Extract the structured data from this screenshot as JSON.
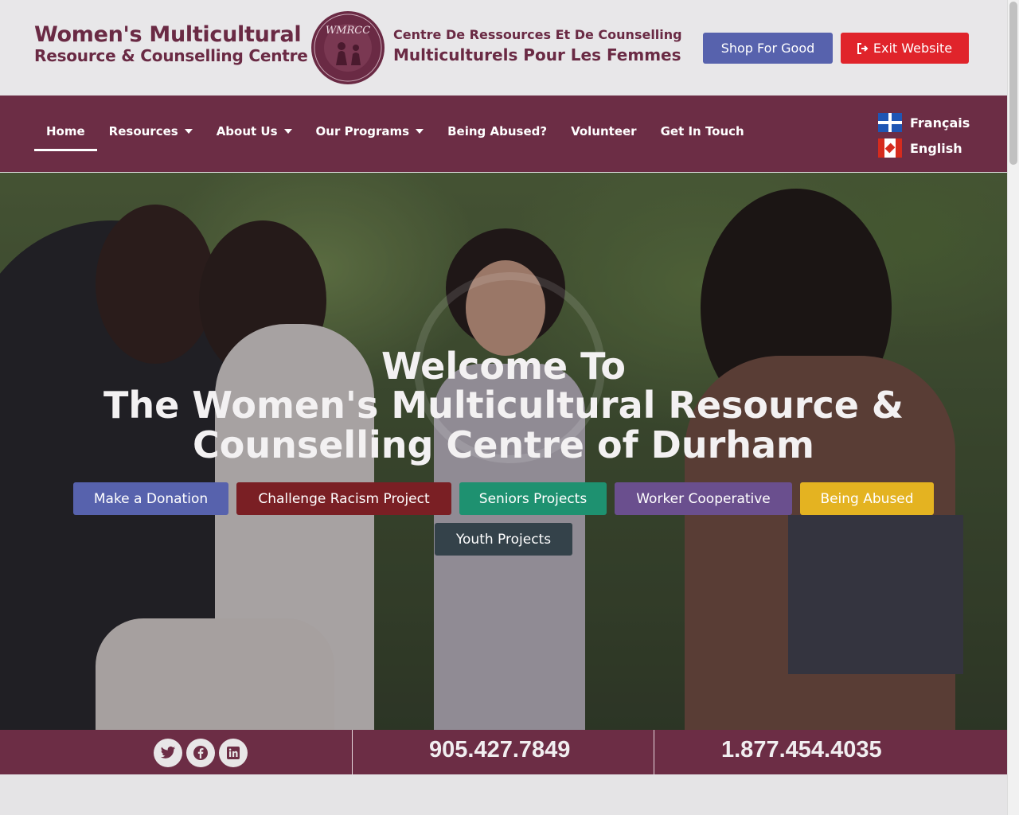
{
  "header": {
    "logo_line1": "Women's Multicultural",
    "logo_line2": "Resource & Counselling Centre",
    "seal_text": "WMRCC",
    "logo_fr_line1": "Centre De Ressources Et De Counselling",
    "logo_fr_line2": "Multiculturels Pour Les Femmes",
    "shop_label": "Shop For Good",
    "exit_label": "Exit Website"
  },
  "nav": {
    "items": [
      {
        "label": "Home",
        "active": true,
        "dropdown": false
      },
      {
        "label": "Resources",
        "active": false,
        "dropdown": true
      },
      {
        "label": "About Us",
        "active": false,
        "dropdown": true
      },
      {
        "label": "Our Programs",
        "active": false,
        "dropdown": true
      },
      {
        "label": "Being Abused?",
        "active": false,
        "dropdown": false
      },
      {
        "label": "Volunteer",
        "active": false,
        "dropdown": false
      },
      {
        "label": "Get In Touch",
        "active": false,
        "dropdown": false
      }
    ],
    "languages": [
      {
        "label": "Français",
        "flag": "quebec-flag-icon"
      },
      {
        "label": "English",
        "flag": "canada-flag-icon"
      }
    ]
  },
  "hero": {
    "title_line1": "Welcome To",
    "title_line2": "The Women's Multicultural Resource &",
    "title_line3": "Counselling Centre of Durham",
    "buttons": [
      {
        "label": "Make a Donation",
        "color": "#5762ad"
      },
      {
        "label": "Challenge Racism Project",
        "color": "#7a1f24"
      },
      {
        "label": "Seniors Projects",
        "color": "#1e9170"
      },
      {
        "label": "Worker Cooperative",
        "color": "#6a4f8e"
      },
      {
        "label": "Being Abused",
        "color": "#e4b321"
      },
      {
        "label": "Youth Projects",
        "color": "#34424a"
      }
    ]
  },
  "contact": {
    "social": [
      "twitter-icon",
      "facebook-icon",
      "linkedin-icon"
    ],
    "phone_local": "905.427.7849",
    "phone_tollfree": "1.877.454.4035"
  },
  "colors": {
    "brand": "#6c2d45",
    "shop": "#5762ad",
    "exit": "#e0242b"
  }
}
